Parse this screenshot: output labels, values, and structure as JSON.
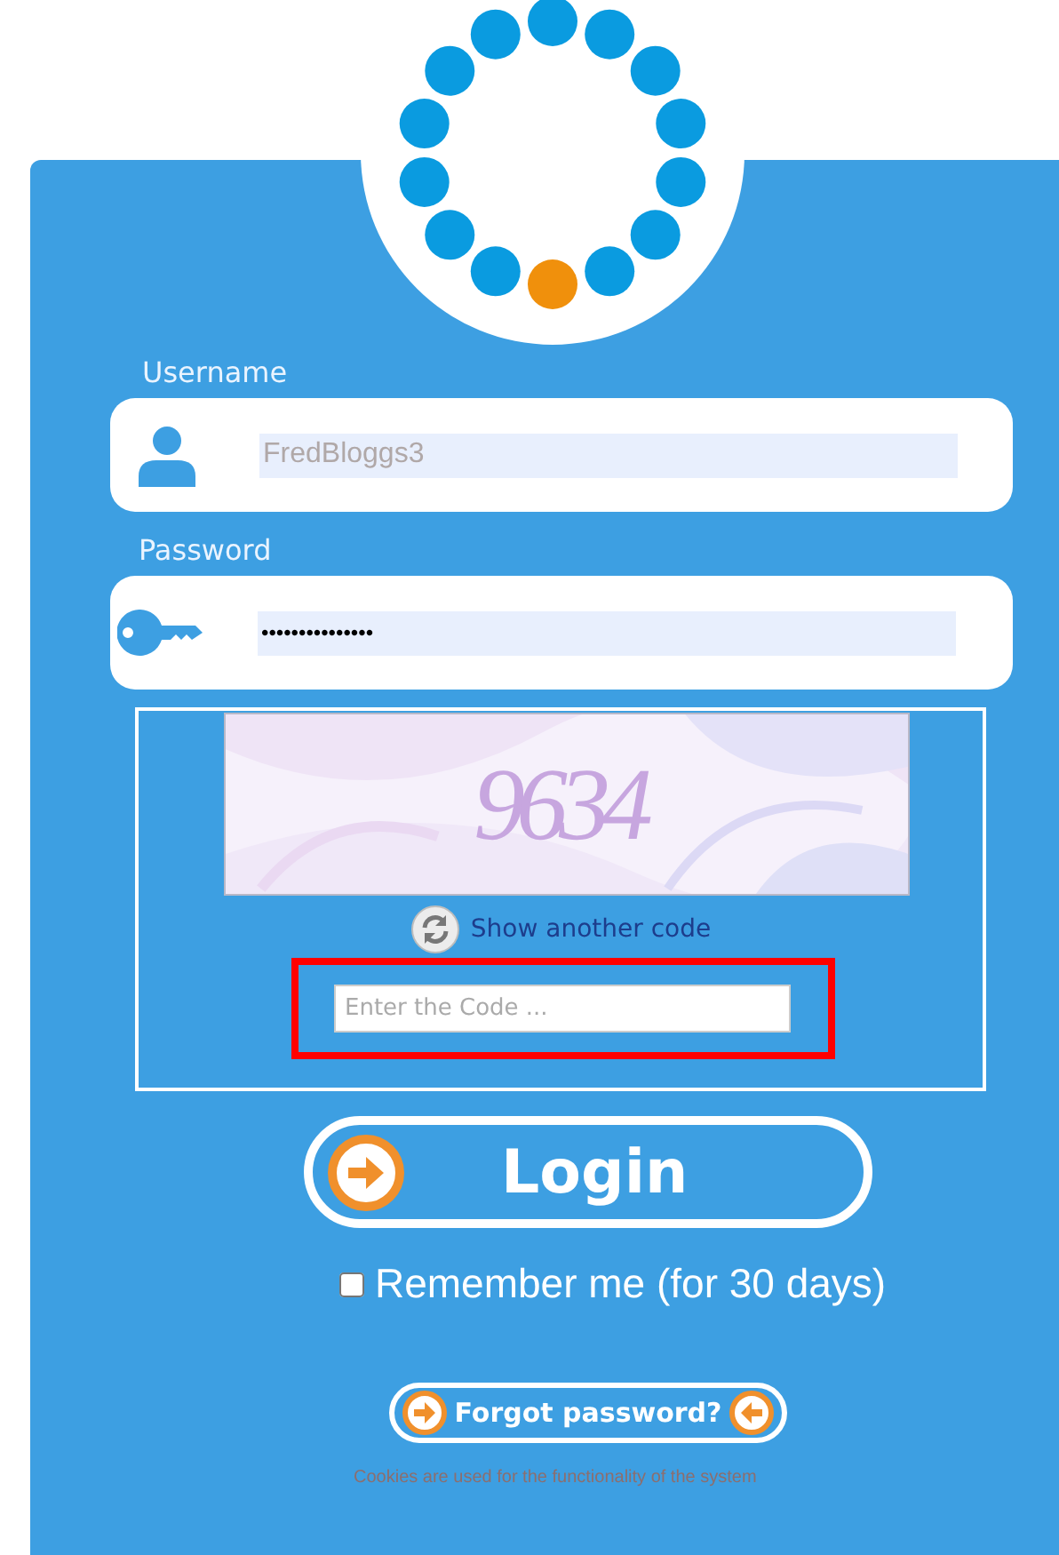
{
  "username": {
    "label": "Username",
    "value": "FredBloggs3"
  },
  "password": {
    "label": "Password",
    "value": "•••••••••••••••"
  },
  "captcha": {
    "code": "9634",
    "refresh_label": "Show another code",
    "placeholder": "Enter the Code ...",
    "highlighted": true
  },
  "login_button": "Login",
  "remember": {
    "label": "Remember me (for 30 days)",
    "checked": false
  },
  "forgot_button": "Forgot password?",
  "cookies_note": "Cookies are used for the functionality of the system"
}
